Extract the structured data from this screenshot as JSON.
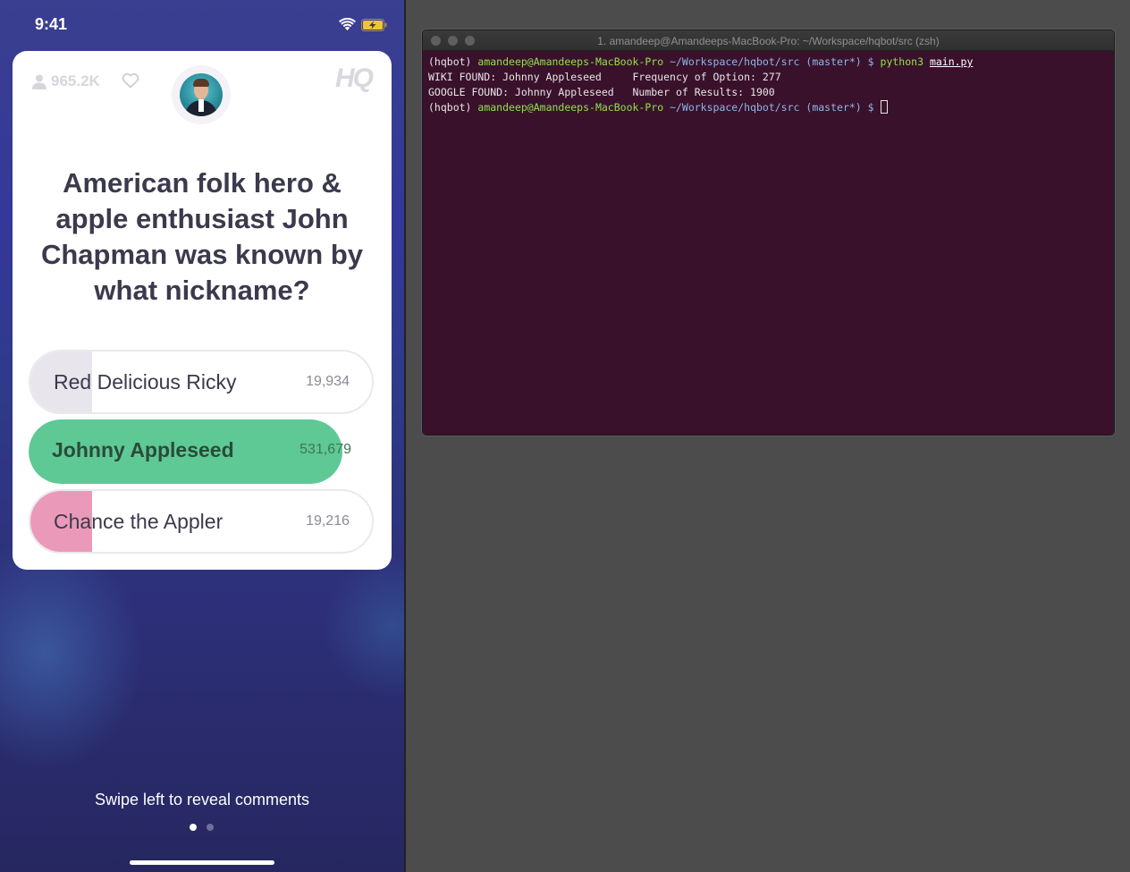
{
  "phone": {
    "status_time": "9:41",
    "viewer_count": "965.2K",
    "logo": "HQ",
    "question": "American folk hero & apple enthusiast John Chapman was known by what nickname?",
    "answers": [
      {
        "label": "Red Delicious Ricky",
        "count": "19,934",
        "fraction": 0.18,
        "color": "#e8e6ec",
        "correct": false
      },
      {
        "label": "Johnny Appleseed",
        "count": "531,679",
        "fraction": 0.91,
        "color": "#5ec995",
        "correct": true
      },
      {
        "label": "Chance the Appler",
        "count": "19,216",
        "fraction": 0.18,
        "color": "#ea9ab8",
        "correct": false
      }
    ],
    "swipe_hint": "Swipe left to reveal comments",
    "page_dots": [
      {
        "active": true
      },
      {
        "active": false
      }
    ],
    "colors": {
      "dot_active": "#ffffff",
      "dot_inactive": "#6f6f9a",
      "battery": "#f4c430"
    }
  },
  "terminal": {
    "title": "1. amandeep@Amandeeps-MacBook-Pro: ~/Workspace/hqbot/src (zsh)",
    "env": "(hqbot)",
    "user_host": "amandeep@Amandeeps-MacBook-Pro",
    "path": "~/Workspace/hqbot/src",
    "branch": "(master*)",
    "prompt_symbol": "$",
    "command": "python3",
    "command_arg": "main.py",
    "output_lines": [
      "WIKI FOUND: Johnny Appleseed     Frequency of Option: 277",
      "GOOGLE FOUND: Johnny Appleseed   Number of Results: 1900"
    ],
    "colors": {
      "background": "#3a112b",
      "user_host": "#8fe34a",
      "path": "#8db7ea"
    }
  }
}
